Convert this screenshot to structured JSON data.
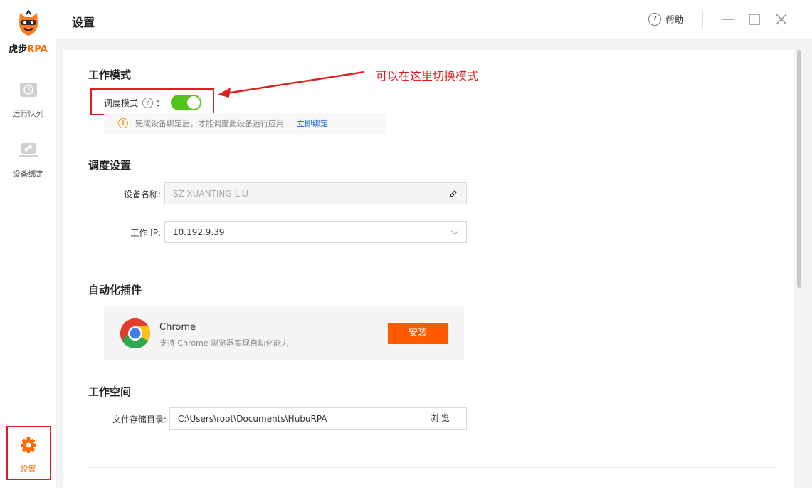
{
  "app": {
    "logo_cn": "虎步",
    "logo_rpa": "RPA",
    "brand_color": "#ff6a00"
  },
  "sidebar": {
    "items": [
      {
        "label": "运行队列",
        "icon": "clock-icon"
      },
      {
        "label": "设备绑定",
        "icon": "laptop-link-icon"
      },
      {
        "label": "设置",
        "icon": "gear-icon",
        "active": true
      }
    ]
  },
  "header": {
    "title": "设置",
    "help_label": "帮助",
    "help_icon": "?"
  },
  "work_mode": {
    "section_title": "工作模式",
    "toggle_label": "调度模式",
    "q_icon": "?",
    "colon": "：",
    "toggle_on": true,
    "toggle_color": "#52c41a",
    "notice_icon": "!",
    "notice_text": "完成设备绑定后，才能调度此设备运行应用",
    "notice_link": "立即绑定"
  },
  "annotation": {
    "text": "可以在这里切换模式",
    "color": "#e02020"
  },
  "dispatch": {
    "section_title": "调度设置",
    "device_name_label": "设备名称:",
    "device_name_value": "SZ-XUANTING-LIU",
    "work_ip_label": "工作 IP:",
    "work_ip_value": "10.192.9.39"
  },
  "plugins": {
    "section_title": "自动化插件",
    "items": [
      {
        "name": "Chrome",
        "desc": "支持 Chrome 浏览器实现自动化能力",
        "button": "安装"
      }
    ],
    "button_color": "#ff5a00"
  },
  "workspace": {
    "section_title": "工作空间",
    "dir_label": "文件存储目录:",
    "dir_value": "C:\\Users\\root\\Documents\\HubuRPA",
    "browse_label": "浏 览"
  }
}
